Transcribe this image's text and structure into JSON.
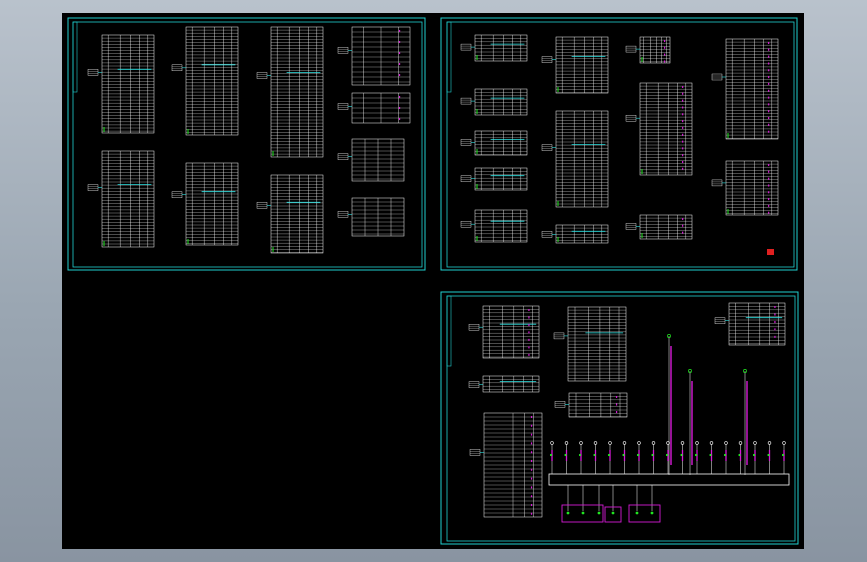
{
  "viewer": {
    "background_gradient": [
      "#b9c2cc",
      "#8994a1"
    ],
    "canvas_color": "#000000"
  },
  "drawing": {
    "sheets": [
      {
        "id": "sheet-top-left"
      },
      {
        "id": "sheet-top-right"
      },
      {
        "id": "sheet-bottom-right"
      }
    ],
    "busbar_label": "",
    "colors": {
      "frame": "#21d1d1",
      "table_lines": "#ffffff",
      "accent_cyan": "#2ee6e6",
      "feeder": "#d61ad6",
      "node": "#21e621",
      "stamp": "#e02020"
    }
  }
}
